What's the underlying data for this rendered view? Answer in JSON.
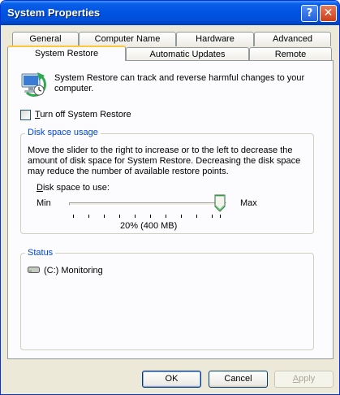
{
  "window": {
    "title": "System Properties",
    "help_glyph": "?",
    "close_glyph": "✕"
  },
  "tabs": {
    "row1": [
      "General",
      "Computer Name",
      "Hardware",
      "Advanced"
    ],
    "row2": [
      "System Restore",
      "Automatic Updates",
      "Remote"
    ],
    "active": "System Restore"
  },
  "intro_text": "System Restore can track and reverse harmful changes to your computer.",
  "turn_off": {
    "label_accel": "T",
    "label_rest": "urn off System Restore",
    "checked": false
  },
  "disk_space": {
    "group_title": "Disk space usage",
    "description": "Move the slider to the right to increase or to the left to decrease the amount of disk space for System Restore. Decreasing the disk space may reduce the number of available restore points.",
    "label_accel": "D",
    "label_rest": "isk space to use:",
    "min_label": "Min",
    "max_label": "Max",
    "value_text": "20% (400 MB)",
    "slider_fraction": 0.94
  },
  "status": {
    "group_title": "Status",
    "drives": [
      {
        "name": "(C:)",
        "state": "Monitoring",
        "icon": "drive-icon"
      }
    ]
  },
  "buttons": {
    "ok": "OK",
    "cancel": "Cancel",
    "apply_accel": "A",
    "apply_rest": "pply"
  },
  "colors": {
    "titlebar": "#0054e3",
    "group_title": "#0046d5",
    "tab_highlight": "#ffc83c"
  }
}
